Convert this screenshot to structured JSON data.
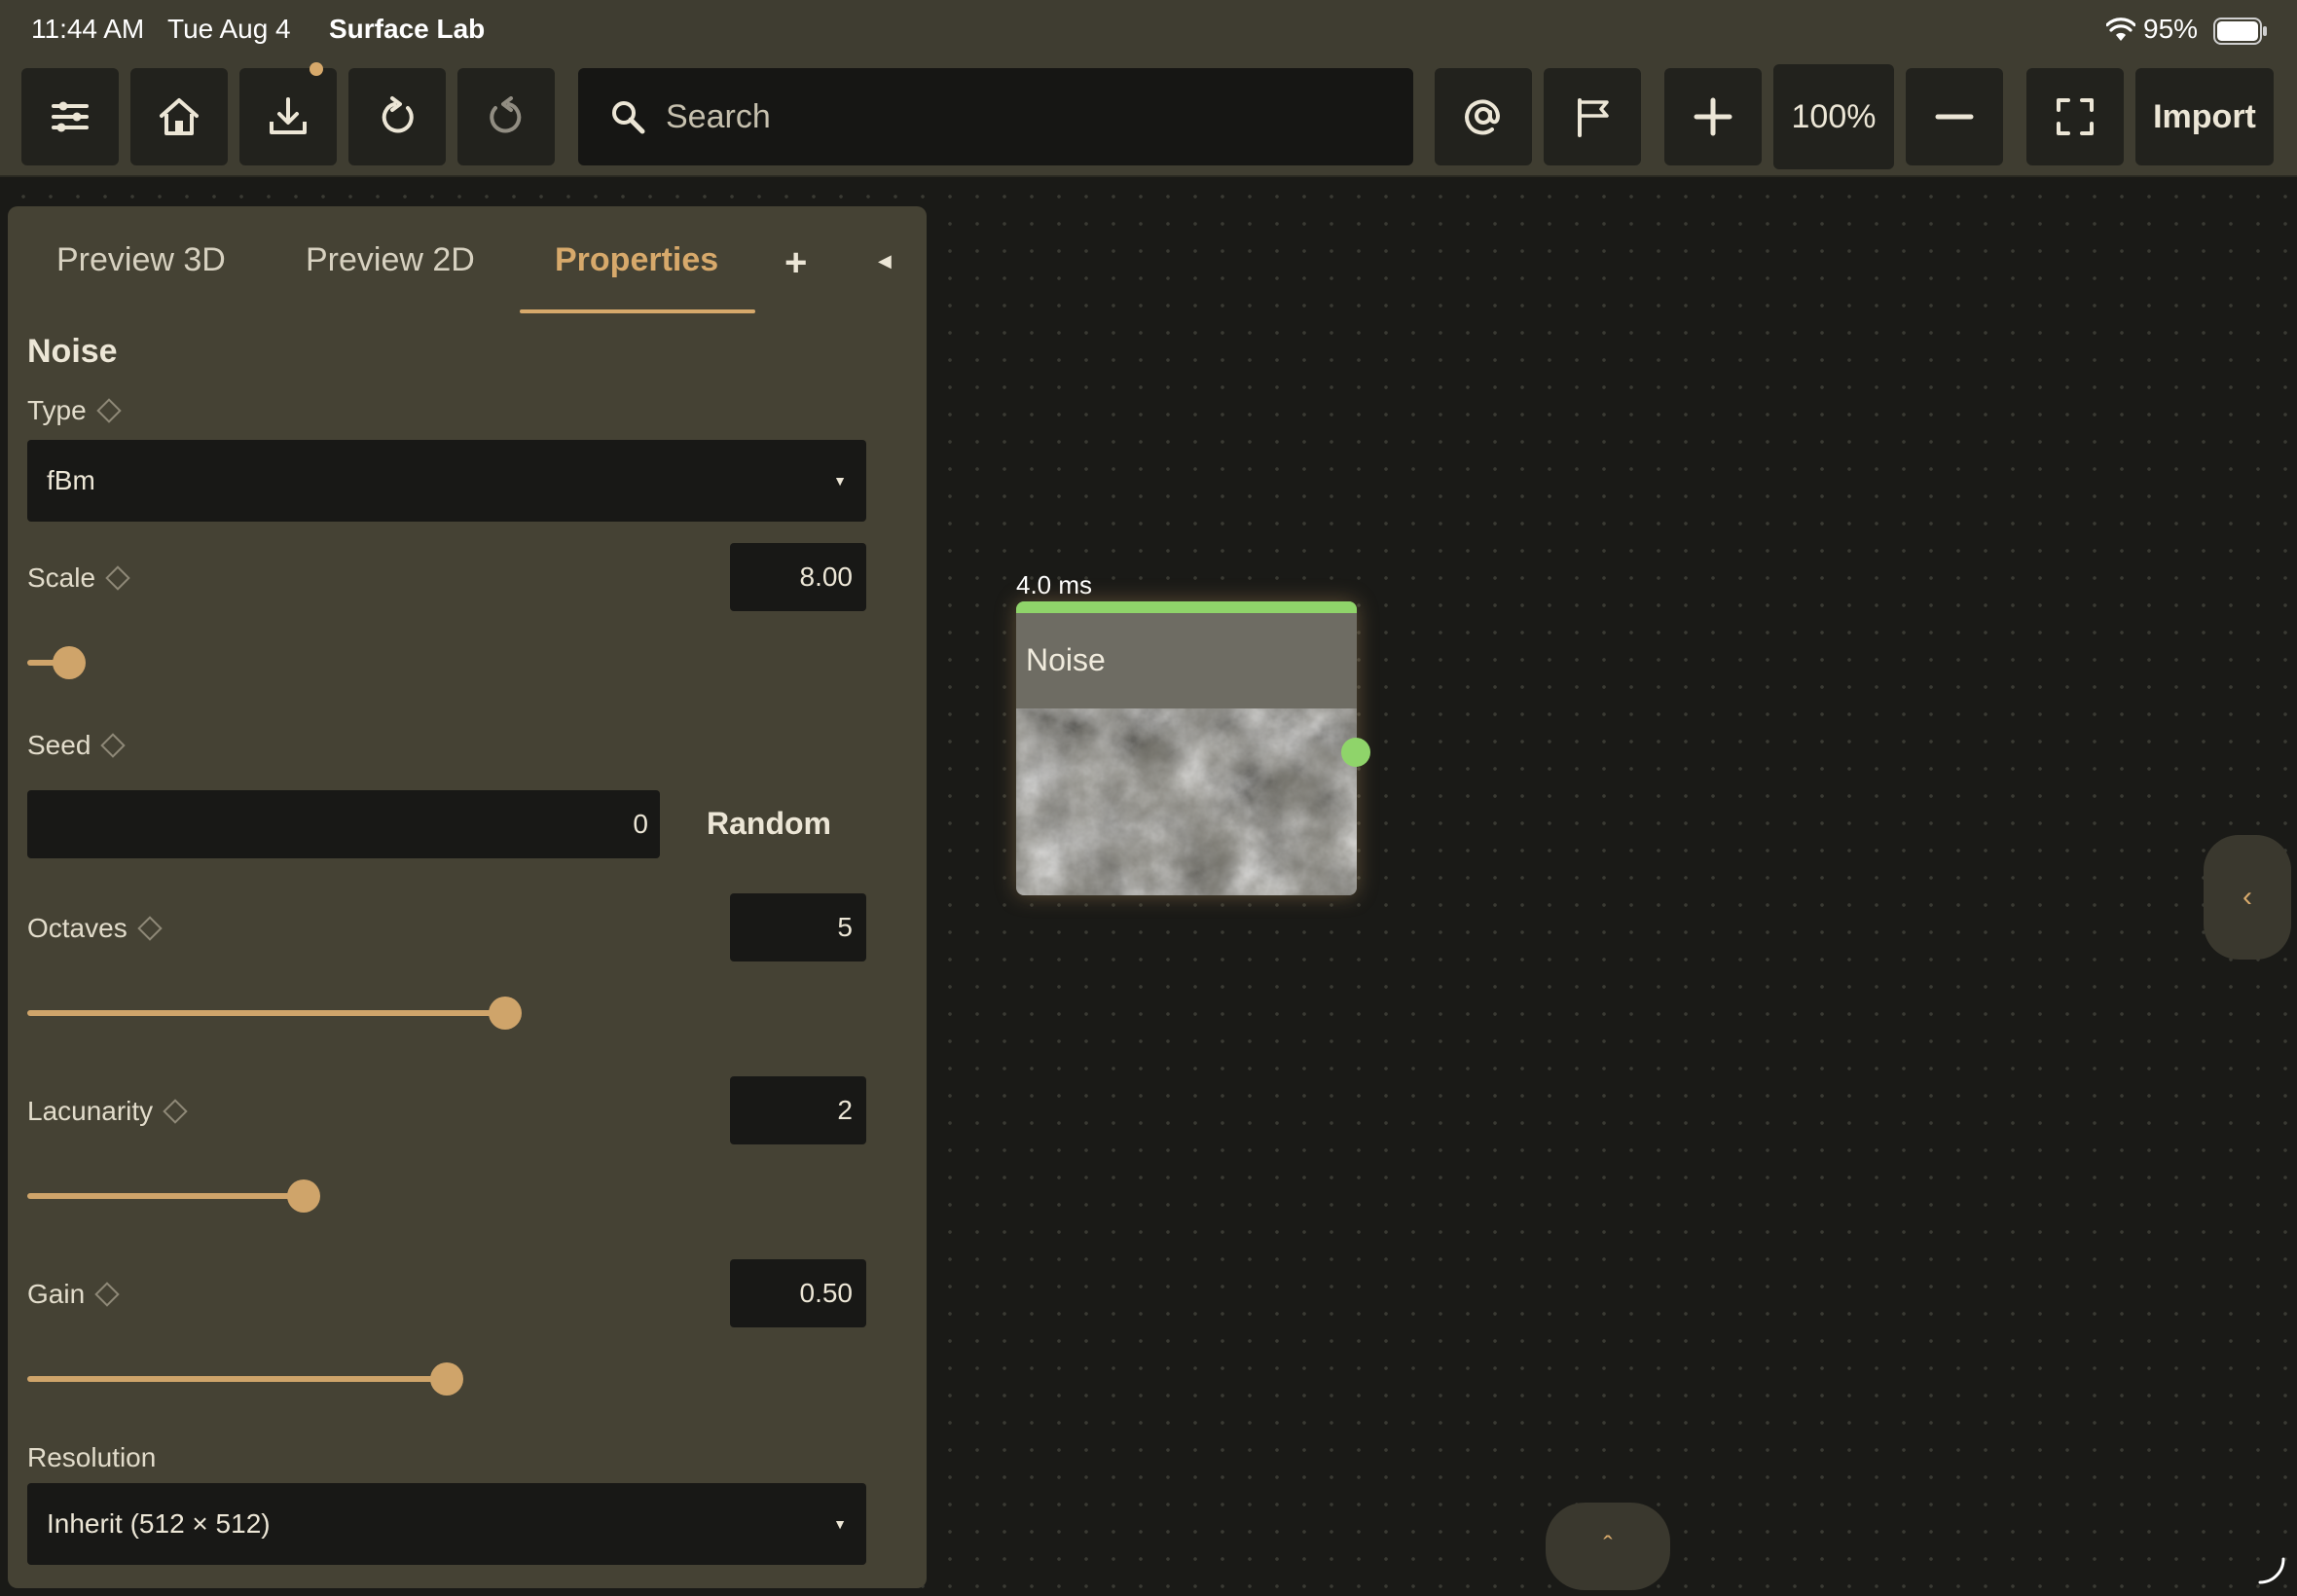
{
  "status_bar": {
    "time": "11:44 AM",
    "date": "Tue Aug 4",
    "app": "Surface Lab",
    "battery": "95%"
  },
  "toolbar": {
    "buttons": [
      "sliders-icon",
      "home-icon",
      "download-icon",
      "redo-icon",
      "undo-icon"
    ],
    "search_placeholder": "Search",
    "zoom": "100%",
    "import_label": "Import",
    "accent": "#d7a96b"
  },
  "panel": {
    "tabs": [
      {
        "label": "Preview 3D",
        "active": false
      },
      {
        "label": "Preview 2D",
        "active": false
      },
      {
        "label": "Properties",
        "active": true
      }
    ],
    "add_tab": "+",
    "node_title": "Noise",
    "type": {
      "label": "Type",
      "value": "fBm"
    },
    "scale": {
      "label": "Scale",
      "value": "8.00",
      "fraction": 0.05
    },
    "seed": {
      "label": "Seed",
      "value": "0",
      "random_label": "Random"
    },
    "octaves": {
      "label": "Octaves",
      "value": "5",
      "fraction": 0.57
    },
    "lacunarity": {
      "label": "Lacunarity",
      "value": "2",
      "fraction": 0.33
    },
    "gain": {
      "label": "Gain",
      "value": "0.50",
      "fraction": 0.5
    },
    "resolution": {
      "label": "Resolution",
      "value": "Inherit (512 × 512)"
    }
  },
  "node": {
    "timing": "4.0 ms",
    "name": "Noise",
    "status_color": "#8fd46a"
  }
}
